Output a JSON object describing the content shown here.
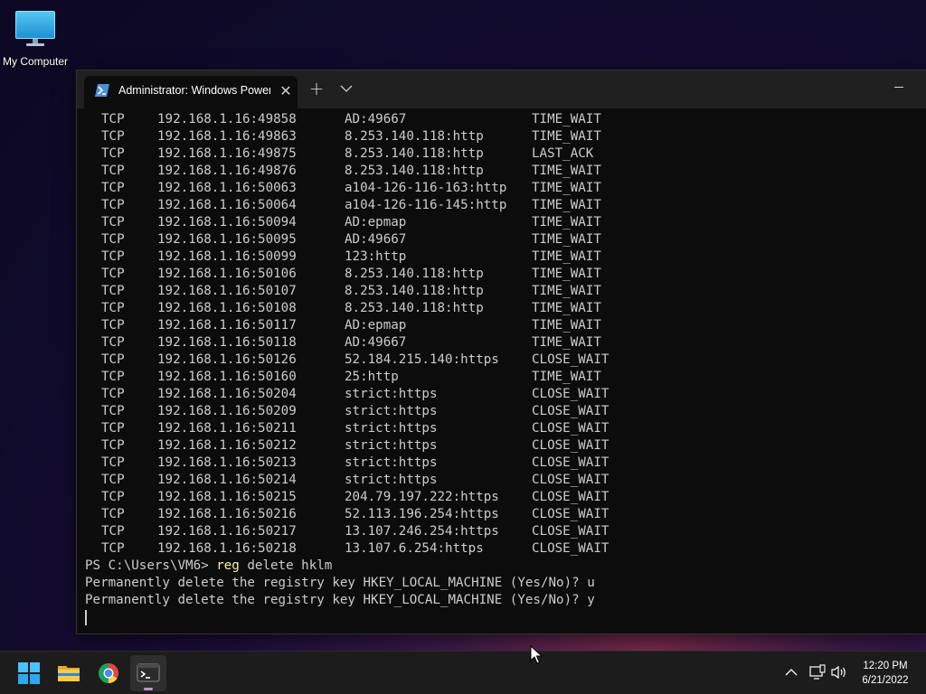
{
  "desktop": {
    "icons": [
      {
        "label": "My Computer",
        "icon": "monitor-icon"
      }
    ]
  },
  "window": {
    "tab": {
      "title": "Administrator: Windows PowerShell",
      "icon": "powershell-icon",
      "close_glyph": "✕"
    },
    "new_tab_glyph": "+",
    "dropdown_icon": "chevron-down-icon",
    "minimize_icon": "minimize-icon"
  },
  "console": {
    "netstat_rows": [
      {
        "proto": "TCP",
        "local": "192.168.1.16:49858",
        "foreign": "AD:49667",
        "state": "TIME_WAIT"
      },
      {
        "proto": "TCP",
        "local": "192.168.1.16:49863",
        "foreign": "8.253.140.118:http",
        "state": "TIME_WAIT"
      },
      {
        "proto": "TCP",
        "local": "192.168.1.16:49875",
        "foreign": "8.253.140.118:http",
        "state": "LAST_ACK"
      },
      {
        "proto": "TCP",
        "local": "192.168.1.16:49876",
        "foreign": "8.253.140.118:http",
        "state": "TIME_WAIT"
      },
      {
        "proto": "TCP",
        "local": "192.168.1.16:50063",
        "foreign": "a104-126-116-163:http",
        "state": "TIME_WAIT"
      },
      {
        "proto": "TCP",
        "local": "192.168.1.16:50064",
        "foreign": "a104-126-116-145:http",
        "state": "TIME_WAIT"
      },
      {
        "proto": "TCP",
        "local": "192.168.1.16:50094",
        "foreign": "AD:epmap",
        "state": "TIME_WAIT"
      },
      {
        "proto": "TCP",
        "local": "192.168.1.16:50095",
        "foreign": "AD:49667",
        "state": "TIME_WAIT"
      },
      {
        "proto": "TCP",
        "local": "192.168.1.16:50099",
        "foreign": "123:http",
        "state": "TIME_WAIT"
      },
      {
        "proto": "TCP",
        "local": "192.168.1.16:50106",
        "foreign": "8.253.140.118:http",
        "state": "TIME_WAIT"
      },
      {
        "proto": "TCP",
        "local": "192.168.1.16:50107",
        "foreign": "8.253.140.118:http",
        "state": "TIME_WAIT"
      },
      {
        "proto": "TCP",
        "local": "192.168.1.16:50108",
        "foreign": "8.253.140.118:http",
        "state": "TIME_WAIT"
      },
      {
        "proto": "TCP",
        "local": "192.168.1.16:50117",
        "foreign": "AD:epmap",
        "state": "TIME_WAIT"
      },
      {
        "proto": "TCP",
        "local": "192.168.1.16:50118",
        "foreign": "AD:49667",
        "state": "TIME_WAIT"
      },
      {
        "proto": "TCP",
        "local": "192.168.1.16:50126",
        "foreign": "52.184.215.140:https",
        "state": "CLOSE_WAIT"
      },
      {
        "proto": "TCP",
        "local": "192.168.1.16:50160",
        "foreign": "25:http",
        "state": "TIME_WAIT"
      },
      {
        "proto": "TCP",
        "local": "192.168.1.16:50204",
        "foreign": "strict:https",
        "state": "CLOSE_WAIT"
      },
      {
        "proto": "TCP",
        "local": "192.168.1.16:50209",
        "foreign": "strict:https",
        "state": "CLOSE_WAIT"
      },
      {
        "proto": "TCP",
        "local": "192.168.1.16:50211",
        "foreign": "strict:https",
        "state": "CLOSE_WAIT"
      },
      {
        "proto": "TCP",
        "local": "192.168.1.16:50212",
        "foreign": "strict:https",
        "state": "CLOSE_WAIT"
      },
      {
        "proto": "TCP",
        "local": "192.168.1.16:50213",
        "foreign": "strict:https",
        "state": "CLOSE_WAIT"
      },
      {
        "proto": "TCP",
        "local": "192.168.1.16:50214",
        "foreign": "strict:https",
        "state": "CLOSE_WAIT"
      },
      {
        "proto": "TCP",
        "local": "192.168.1.16:50215",
        "foreign": "204.79.197.222:https",
        "state": "CLOSE_WAIT"
      },
      {
        "proto": "TCP",
        "local": "192.168.1.16:50216",
        "foreign": "52.113.196.254:https",
        "state": "CLOSE_WAIT"
      },
      {
        "proto": "TCP",
        "local": "192.168.1.16:50217",
        "foreign": "13.107.246.254:https",
        "state": "CLOSE_WAIT"
      },
      {
        "proto": "TCP",
        "local": "192.168.1.16:50218",
        "foreign": "13.107.6.254:https",
        "state": "CLOSE_WAIT"
      }
    ],
    "prompt": "PS C:\\Users\\VM6> ",
    "command_keyword": "reg",
    "command_args": " delete hklm",
    "output_lines": [
      "Permanently delete the registry key HKEY_LOCAL_MACHINE (Yes/No)? u",
      "Permanently delete the registry key HKEY_LOCAL_MACHINE (Yes/No)? y"
    ]
  },
  "taskbar": {
    "apps": [
      {
        "name": "start-button",
        "icon": "windows-logo-icon"
      },
      {
        "name": "file-explorer",
        "icon": "folder-icon"
      },
      {
        "name": "chrome",
        "icon": "chrome-icon"
      },
      {
        "name": "terminal",
        "icon": "terminal-icon",
        "active": true
      }
    ],
    "tray": {
      "chevron_icon": "chevron-up-icon",
      "network_icon": "network-icon",
      "volume_icon": "volume-icon",
      "time": "12:20 PM",
      "date": "6/21/2022"
    }
  },
  "colors": {
    "console_bg": "#0c0c0c",
    "console_text": "#cccccc",
    "command_keyword": "#f9f1a5",
    "titlebar": "#202020",
    "taskbar": "#1c1c1c"
  }
}
